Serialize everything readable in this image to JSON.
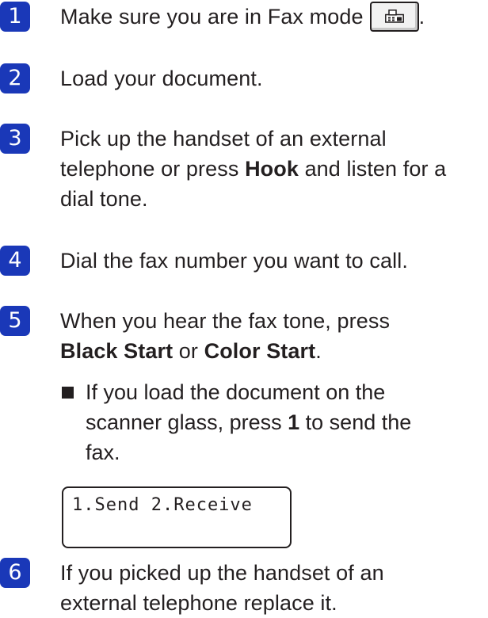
{
  "steps": [
    {
      "num": "1",
      "text": "Make sure you are in Fax mode",
      "after": "."
    },
    {
      "num": "2",
      "text": "Load your document."
    },
    {
      "num": "3",
      "line1_pre": "Pick up the handset of an external",
      "line2_pre": "telephone or press ",
      "hook_label": "Hook",
      "line2_post": " and listen for a",
      "line3": "dial tone."
    },
    {
      "num": "4",
      "text": "Dial the fax number you want to call."
    },
    {
      "num": "5",
      "line1": "When you hear the fax tone, press",
      "black_start": "Black Start",
      "or": " or ",
      "color_start": "Color Start",
      "period": "."
    },
    {
      "num": "6",
      "line1": "If you picked up the handset of an",
      "line2": "external telephone replace it."
    }
  ],
  "sub_bullet": {
    "line1": "If you load the document on the",
    "line2_pre": "scanner glass, press ",
    "key": "1",
    "line2_post": " to send the",
    "line3": "fax."
  },
  "lcd": {
    "text": "1.Send 2.Receive"
  },
  "icons": {
    "fax_mode": "fax-icon"
  },
  "colors": {
    "badge": "#1a38b8"
  }
}
